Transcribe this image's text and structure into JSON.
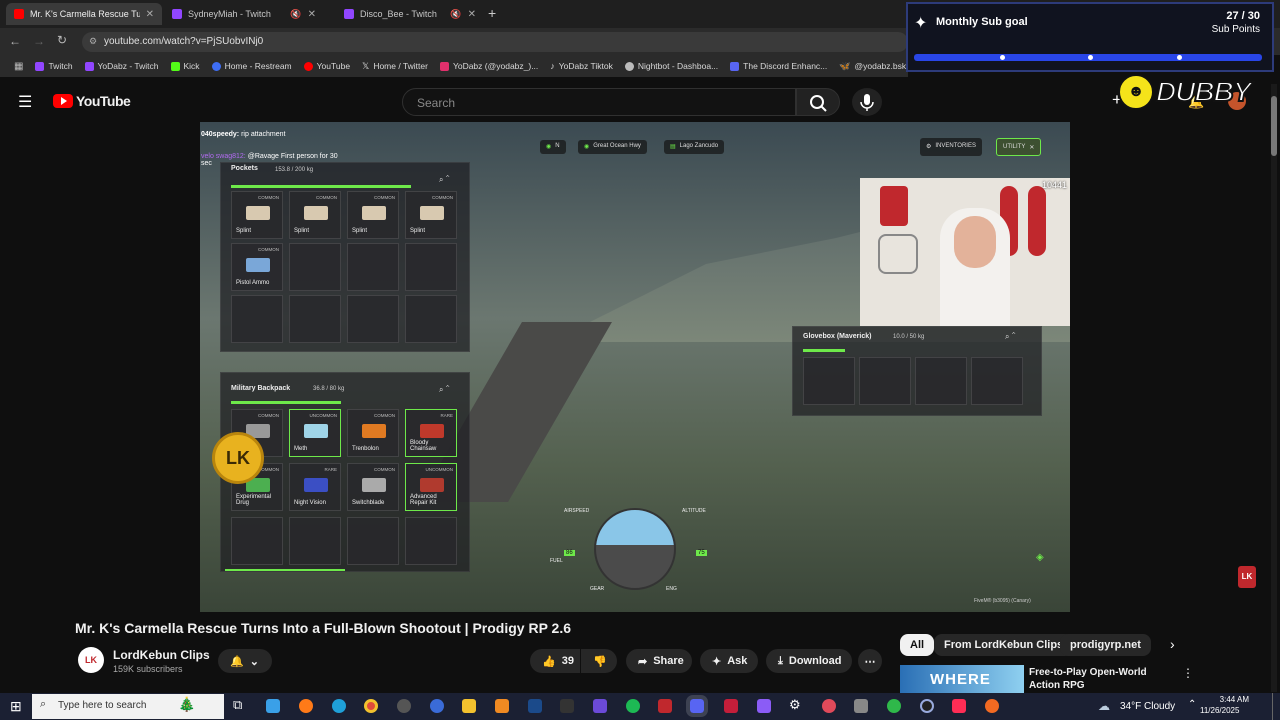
{
  "browser": {
    "tabs": [
      {
        "title": "Mr. K's Carmella Rescue Tu",
        "active": true
      },
      {
        "title": "SydneyMiah - Twitch",
        "active": false
      },
      {
        "title": "Disco_Bee - Twitch",
        "active": false
      }
    ],
    "new_tab": "+",
    "url": "youtube.com/watch?v=PjSUobvINj0",
    "bookmarks": [
      {
        "label": "Twitch",
        "color": "#9146ff"
      },
      {
        "label": "YoDabz - Twitch",
        "color": "#9146ff"
      },
      {
        "label": "Kick",
        "color": "#53fc18"
      },
      {
        "label": "Home - Restream",
        "color": "#3e6ef5"
      },
      {
        "label": "YouTube",
        "color": "#ff0000"
      },
      {
        "label": "Home / Twitter",
        "color": "#e7e7e7"
      },
      {
        "label": "YoDabz (@yodabz_)...",
        "color": "#e1306c"
      },
      {
        "label": "YoDabz Tiktok",
        "color": "#e7e7e7"
      },
      {
        "label": "Nightbot - Dashboa...",
        "color": "#e7e7e7"
      },
      {
        "label": "The Discord Enhanc...",
        "color": "#e7e7e7"
      },
      {
        "label": "@yodabz.bsky.socia...",
        "color": "#1185fe"
      }
    ]
  },
  "sub_goal": {
    "title": "Monthly Sub goal",
    "count": "27 / 30",
    "unit": "Sub Points",
    "progress": 0.9
  },
  "overlay_logo": "DUBBY",
  "youtube": {
    "logo": "YouTube",
    "search_placeholder": "Search",
    "video": {
      "title": "Mr. K's Carmella Rescue Turns Into a Full-Blown Shootout | Prodigy RP 2.6",
      "channel": "LordKebun Clips",
      "subscribers": "159K subscribers",
      "likes": "39",
      "share": "Share",
      "ask": "Ask",
      "download": "Download"
    },
    "chips": [
      "All",
      "From LordKebun Clips",
      "prodigyrp.net"
    ],
    "recommended": {
      "title": "Free-to-Play Open-World Action RPG",
      "thumb_text": "WHERE"
    }
  },
  "game": {
    "chat": [
      {
        "user": "040speedy:",
        "msg": "rip attachment"
      },
      {
        "user": "velo swag812:",
        "msg": "@Ravage First person for 30 sec"
      }
    ],
    "hud_chips": [
      "N",
      "Great Ocean Hwy",
      "Lago Zancudo"
    ],
    "top_buttons": [
      "INVENTORIES",
      "UTILITY"
    ],
    "pockets": {
      "title": "Pockets",
      "weight": "153.8 / 200 kg",
      "items": [
        {
          "name": "Splint",
          "tag": "COMMON"
        },
        {
          "name": "Splint",
          "tag": "COMMON"
        },
        {
          "name": "Splint",
          "tag": "COMMON"
        },
        {
          "name": "Splint",
          "tag": "COMMON"
        },
        {
          "name": "Pistol Ammo",
          "tag": "COMMON"
        }
      ]
    },
    "backpack": {
      "title": "Military Backpack",
      "weight": "36.8 / 80 kg",
      "items": [
        {
          "name": "",
          "tag": "COMMON"
        },
        {
          "name": "Meth",
          "tag": "UNCOMMON"
        },
        {
          "name": "Trenbolon",
          "tag": "COMMON"
        },
        {
          "name": "Bloody Chainsaw",
          "tag": "RARE"
        },
        {
          "name": "Experimental Drug",
          "tag": "UNCOMMON"
        },
        {
          "name": "Night Vision",
          "tag": "RARE"
        },
        {
          "name": "Switchblade",
          "tag": "COMMON"
        },
        {
          "name": "Advanced Repair Kit",
          "tag": "UNCOMMON"
        }
      ]
    },
    "glovebox": {
      "title": "Glovebox (Maverick)",
      "weight": "10.0 / 50 kg"
    },
    "webcam_count": "10441",
    "flight": {
      "airspeed": "AIRSPEED",
      "altitude": "ALTITUDE",
      "fuel": "FUEL",
      "gear": "GEAR",
      "eng": "ENG",
      "speed_val": "86",
      "alt_val": "75"
    },
    "build": "FiveM® (b3095) (Canary)"
  },
  "taskbar": {
    "search_placeholder": "Type here to search",
    "weather": "34°F  Cloudy",
    "time": "3:44 AM",
    "date": "11/26/2025"
  }
}
